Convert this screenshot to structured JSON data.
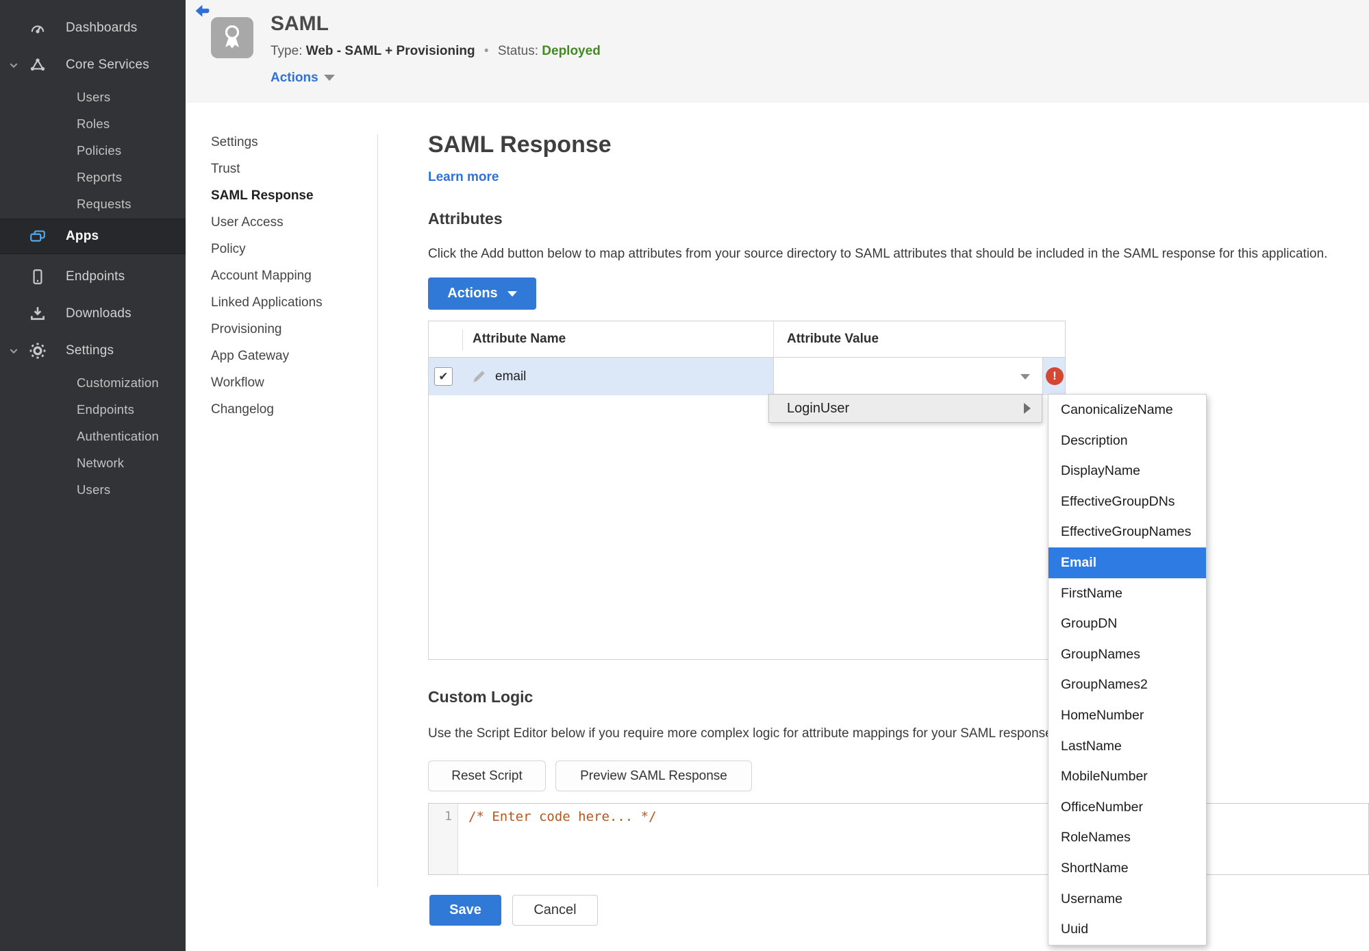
{
  "colors": {
    "accent_blue": "#3079d6",
    "status_green": "#448a24",
    "error_red": "#d64733",
    "code_orange": "#b4561f",
    "sidebar_bg": "#323337",
    "row_highlight": "#dce8f8"
  },
  "sidebar": {
    "items": [
      {
        "label": "Dashboards",
        "icon": "dashboard-gauge"
      },
      {
        "label": "Core Services",
        "icon": "core-services"
      },
      {
        "label": "Users"
      },
      {
        "label": "Roles"
      },
      {
        "label": "Policies"
      },
      {
        "label": "Reports"
      },
      {
        "label": "Requests"
      },
      {
        "label": "Apps",
        "icon": "apps",
        "cls": "selected"
      },
      {
        "label": "Endpoints",
        "icon": "phone",
        "cls": "after-selected"
      },
      {
        "label": "Downloads",
        "icon": "download"
      },
      {
        "label": "Settings",
        "icon": "gear"
      },
      {
        "label": "Customization"
      },
      {
        "label": "Endpoints"
      },
      {
        "label": "Authentication"
      },
      {
        "label": "Network"
      },
      {
        "label": "Users"
      }
    ]
  },
  "header": {
    "app_name": "SAML",
    "type_label": "Type:",
    "type_value": "Web - SAML + Provisioning",
    "separator": "•",
    "status_label": "Status:",
    "status_value": "Deployed",
    "actions_label": "Actions"
  },
  "subnav": {
    "items": [
      {
        "label": "Settings"
      },
      {
        "label": "Trust"
      },
      {
        "label": "SAML Response",
        "cls": "active"
      },
      {
        "label": "User Access"
      },
      {
        "label": "Policy"
      },
      {
        "label": "Account Mapping"
      },
      {
        "label": "Linked Applications"
      },
      {
        "label": "Provisioning"
      },
      {
        "label": "App Gateway"
      },
      {
        "label": "Workflow"
      },
      {
        "label": "Changelog"
      }
    ]
  },
  "main": {
    "title": "SAML Response",
    "learn_more": "Learn more",
    "attributes": {
      "heading": "Attributes",
      "description": "Click the Add button below to map attributes from your source directory to SAML attributes that should be included in the SAML response for this application.",
      "actions_button": "Actions"
    },
    "table": {
      "col_name": "Attribute Name",
      "col_value": "Attribute Value",
      "row": {
        "name": "email",
        "value": "",
        "checked": "✔",
        "error": "!"
      }
    },
    "dropdown": {
      "label": "LoginUser"
    },
    "submenu": {
      "items": [
        {
          "label": "CanonicalizeName"
        },
        {
          "label": "Description"
        },
        {
          "label": "DisplayName"
        },
        {
          "label": "EffectiveGroupDNs"
        },
        {
          "label": "EffectiveGroupNames"
        },
        {
          "label": "Email",
          "cls": "selected"
        },
        {
          "label": "FirstName"
        },
        {
          "label": "GroupDN"
        },
        {
          "label": "GroupNames"
        },
        {
          "label": "GroupNames2"
        },
        {
          "label": "HomeNumber"
        },
        {
          "label": "LastName"
        },
        {
          "label": "MobileNumber"
        },
        {
          "label": "OfficeNumber"
        },
        {
          "label": "RoleNames"
        },
        {
          "label": "ShortName"
        },
        {
          "label": "Username"
        },
        {
          "label": "Uuid"
        }
      ]
    },
    "custom_logic": {
      "heading": "Custom Logic",
      "description": "Use the Script Editor below if you require more complex logic for attribute mappings for your SAML response.",
      "reset_button": "Reset Script",
      "preview_button": "Preview SAML Response",
      "editor": {
        "line_number": "1",
        "code": "/* Enter code here... */"
      }
    },
    "footer": {
      "save": "Save",
      "cancel": "Cancel"
    }
  }
}
